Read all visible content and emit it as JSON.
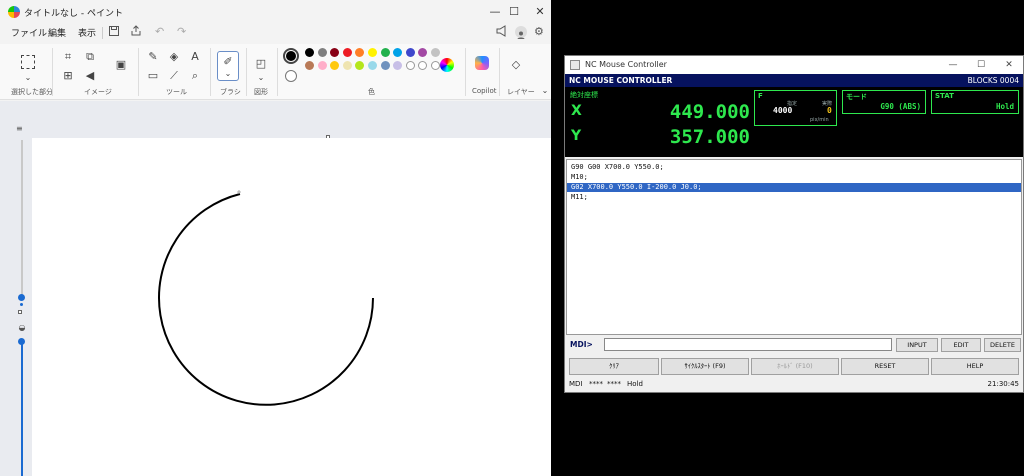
{
  "paint": {
    "title": "タイトルなし - ペイント",
    "window_controls": {
      "minimize": "—",
      "maximize": "☐",
      "close": "✕"
    },
    "menu": [
      "ファイル",
      "編集",
      "表示"
    ],
    "groups": {
      "selection": "選択した部分",
      "image": "イメージ",
      "tools": "ツール",
      "brushes": "ブラシ",
      "shapes": "図形",
      "colors": "色",
      "copilot": "Copilot",
      "layers": "レイヤー"
    },
    "palette": [
      "#000000",
      "#7f7f7f",
      "#880015",
      "#ed1c24",
      "#ff7f27",
      "#fff200",
      "#22b14c",
      "#00a2e8",
      "#3f48cc",
      "#a349a4",
      "#c3c3c3",
      "#b97a57",
      "#ffaec9",
      "#ffc90e",
      "#efe4b0",
      "#b5e61d",
      "#99d9ea",
      "#7092be",
      "#c8bfe7"
    ],
    "primary_color": "#000000",
    "secondary_color": "#ffffff",
    "drawing": {
      "type": "arc",
      "stroke": "#000000"
    }
  },
  "nc": {
    "window_title": "NC Mouse Controller",
    "header_title": "NC MOUSE CONTROLLER",
    "blocks": "BLOCKS 0004",
    "position_label": "絶対座標",
    "x_label": "X",
    "x_value": "449.000",
    "y_label": "Y",
    "y_value": "357.000",
    "feed": {
      "label": "F",
      "set_label": "指定",
      "actual_label": "実際",
      "set_value": "4000",
      "actual_value": "0",
      "unit": "pix/min"
    },
    "mode": {
      "label": "モード",
      "value": "G90 (ABS)"
    },
    "stat": {
      "label": "STAT",
      "value": "Hold"
    },
    "program": [
      {
        "text": "G90 G00 X700.0 Y550.0;",
        "selected": false
      },
      {
        "text": "M10;",
        "selected": false
      },
      {
        "text": "G02 X700.0 Y550.0 I-200.0 J0.0;",
        "selected": true
      },
      {
        "text": "M11;",
        "selected": false
      }
    ],
    "mdi_label": "MDI>",
    "mdi_value": "",
    "buttons": {
      "input": "INPUT",
      "edit": "EDIT",
      "delete": "DELETE",
      "clear": "ｸﾘｱ",
      "cycle_start": "ｻｲｸﾙｽﾀｰﾄ (F9)",
      "feed_hold": "ﾎｰﾙﾄﾞ (F10)",
      "reset": "RESET",
      "help": "HELP"
    },
    "status": {
      "mode": "MDI",
      "f1": "****",
      "f2": "****",
      "state": "Hold",
      "time": "21:30:45"
    }
  }
}
